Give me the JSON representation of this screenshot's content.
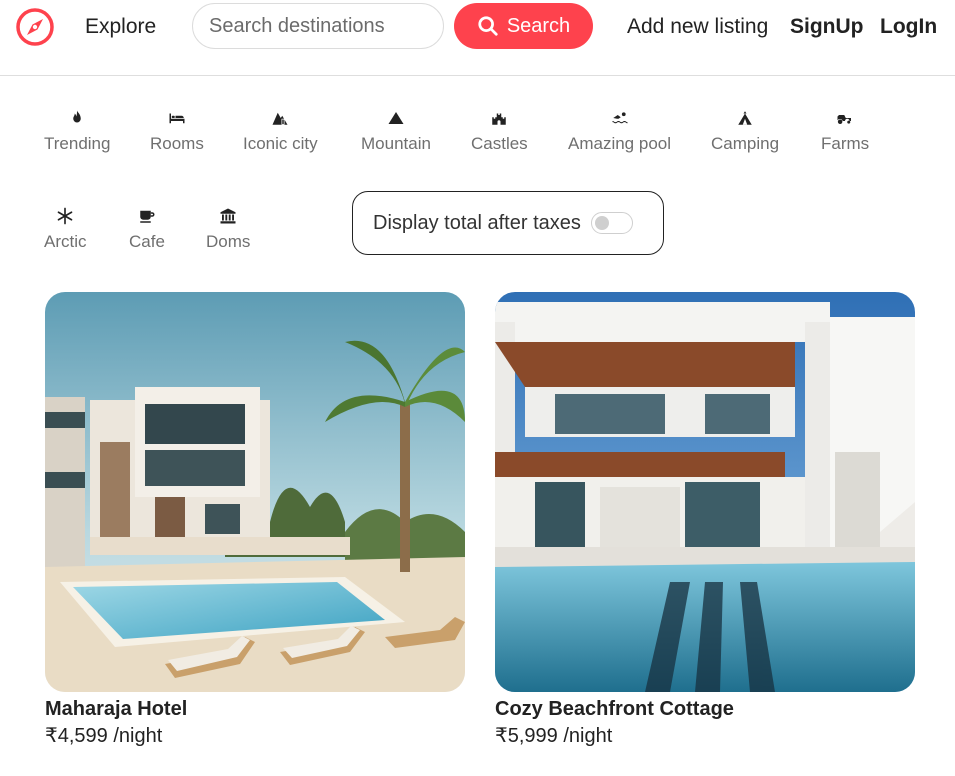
{
  "navbar": {
    "logo_icon": "compass-icon",
    "explore_label": "Explore",
    "search_placeholder": "Search destinations",
    "search_button_label": "Search",
    "add_listing_label": "Add new listing",
    "signup_label": "SignUp",
    "login_label": "LogIn",
    "brand_color": "#fe424d"
  },
  "filters": [
    {
      "label": "Trending",
      "icon": "fire-icon"
    },
    {
      "label": "Rooms",
      "icon": "bed-icon"
    },
    {
      "label": "Iconic city",
      "icon": "city-icon"
    },
    {
      "label": "Mountain",
      "icon": "mountain-icon"
    },
    {
      "label": "Castles",
      "icon": "castle-icon"
    },
    {
      "label": "Amazing pool",
      "icon": "swimmer-icon"
    },
    {
      "label": "Camping",
      "icon": "tent-icon"
    },
    {
      "label": "Farms",
      "icon": "tractor-icon"
    },
    {
      "label": "Arctic",
      "icon": "snowflake-icon"
    },
    {
      "label": "Cafe",
      "icon": "coffee-icon"
    },
    {
      "label": "Doms",
      "icon": "dome-icon"
    }
  ],
  "tax_toggle": {
    "label": "Display total after taxes",
    "enabled": false
  },
  "listings": [
    {
      "title": "Maharaja Hotel",
      "price": "₹4,599 /night"
    },
    {
      "title": "Cozy Beachfront Cottage",
      "price": "₹5,999 /night"
    }
  ]
}
